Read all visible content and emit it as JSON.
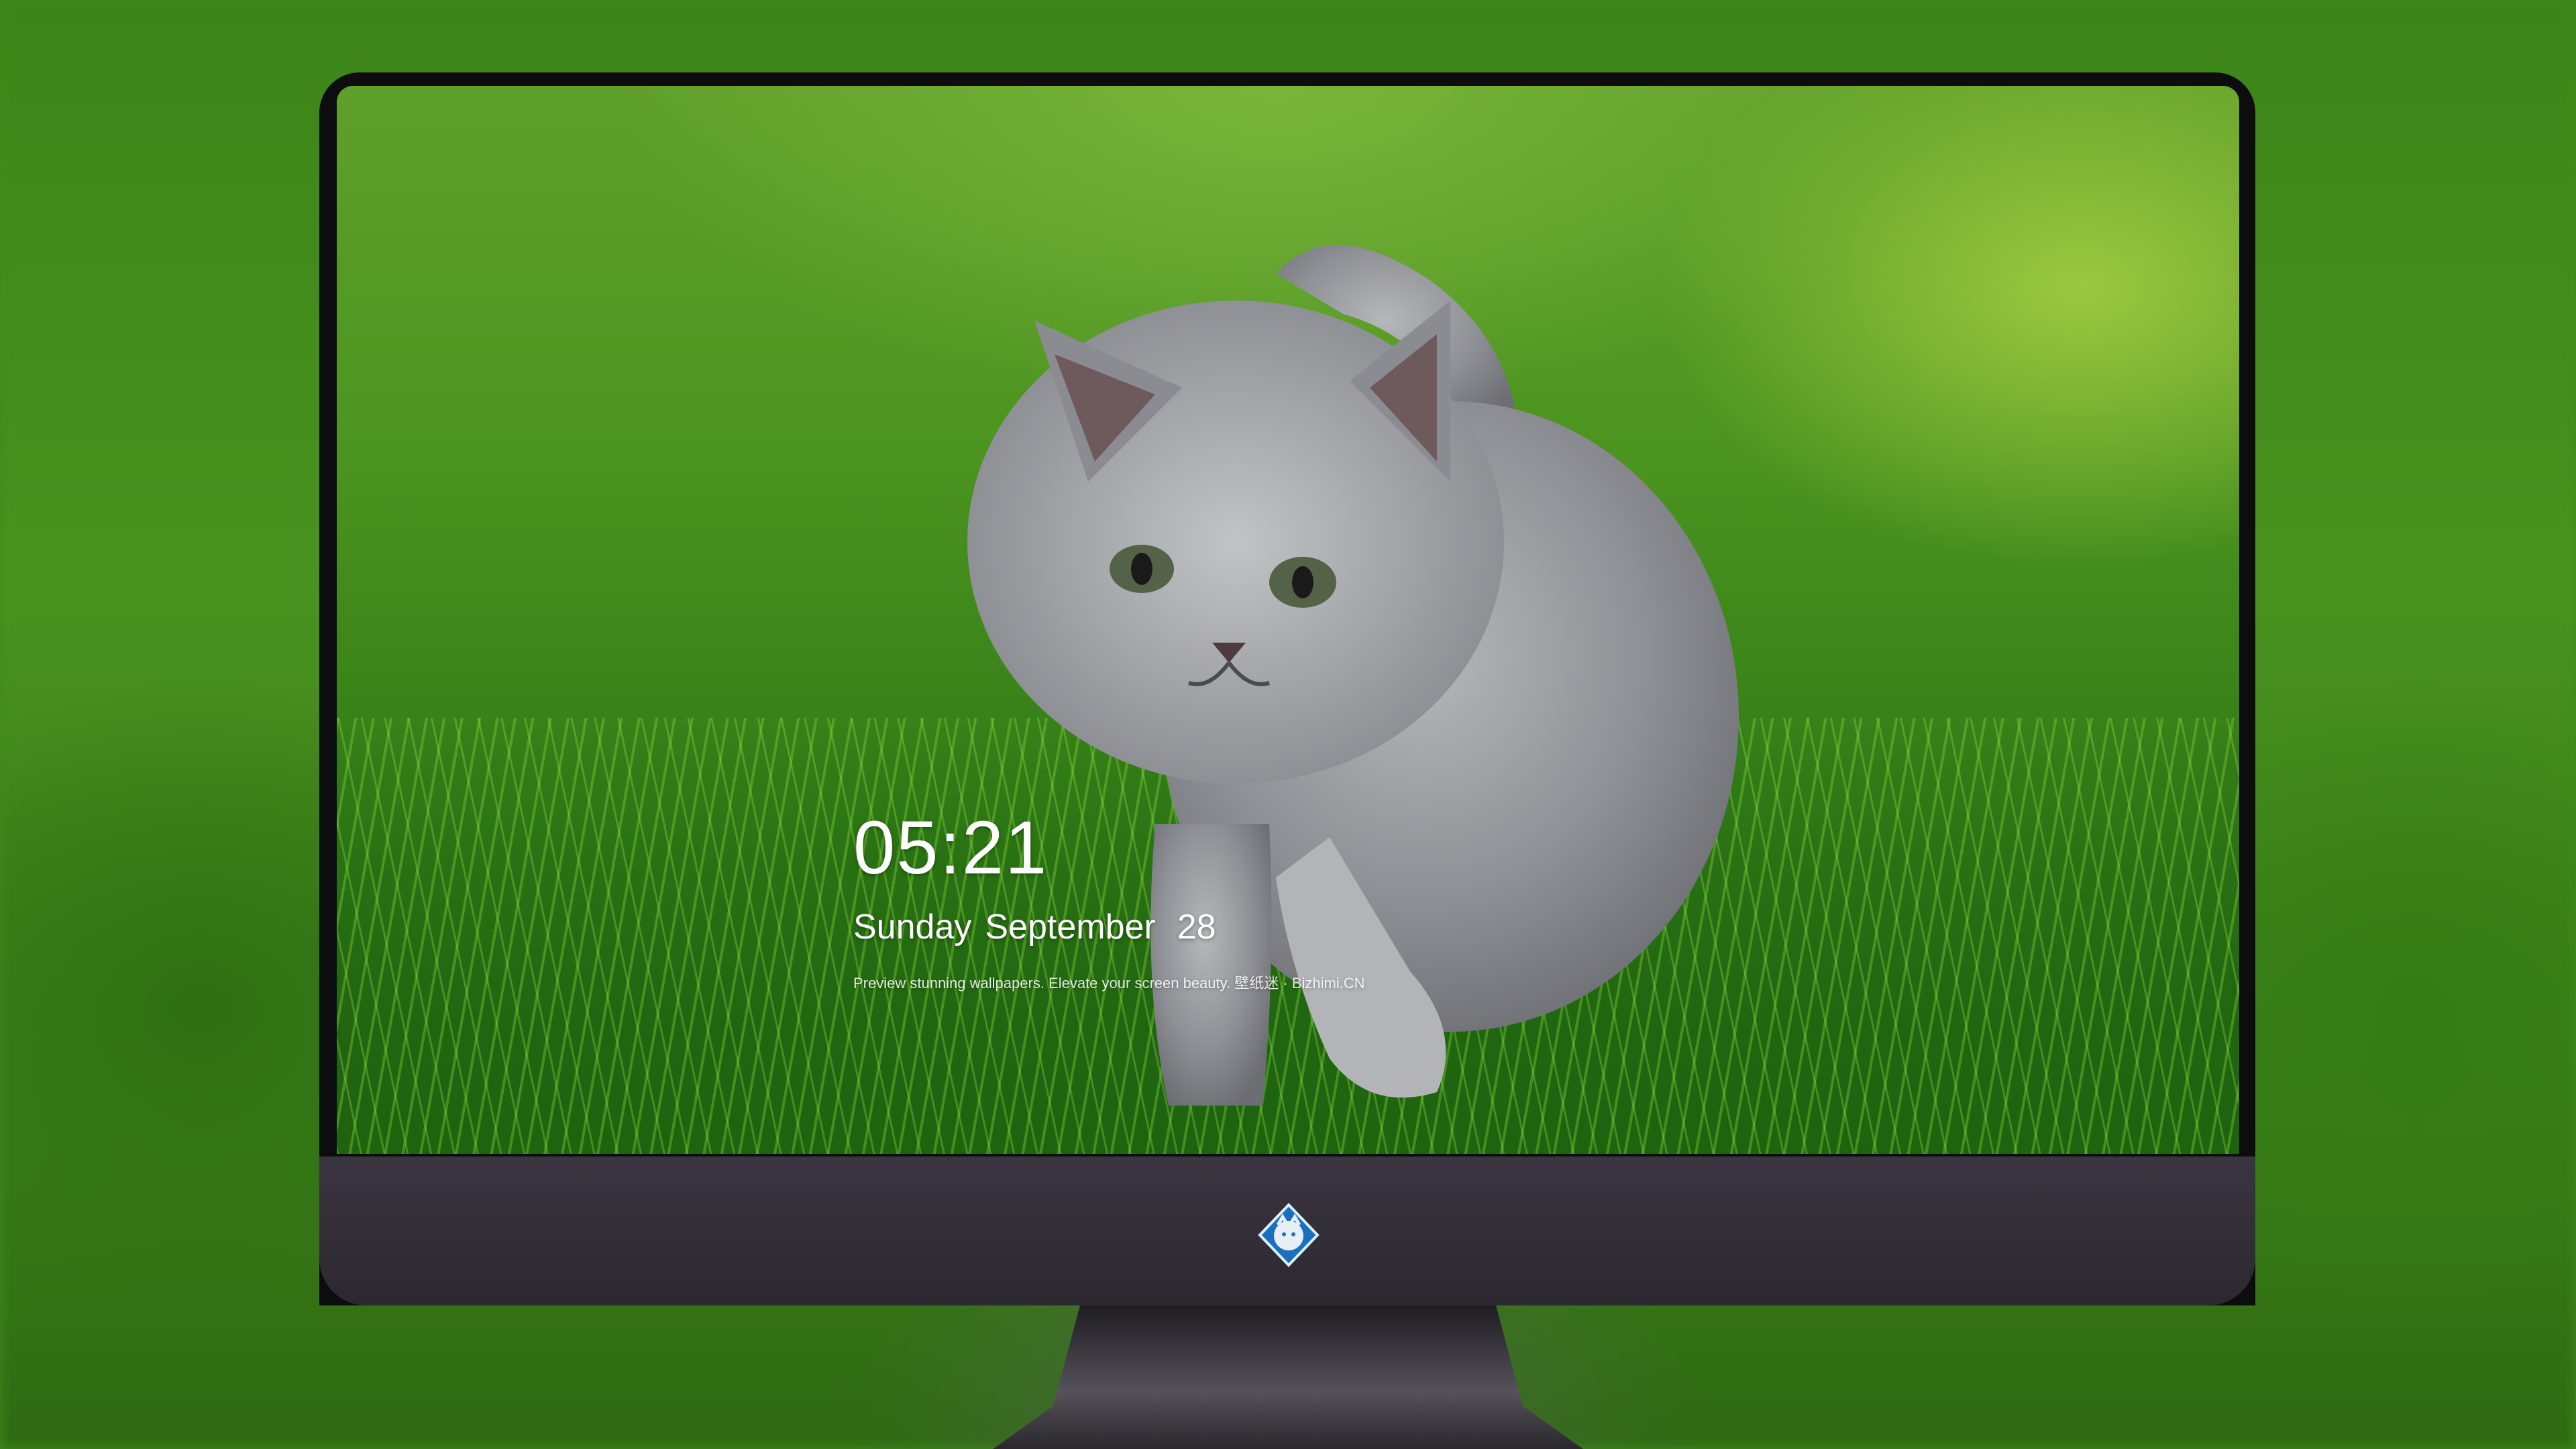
{
  "lockscreen": {
    "time": "05:21",
    "weekday": "Sunday",
    "month": "September",
    "day": "28",
    "caption": "Preview stunning wallpapers. Elevate your screen beauty. 壁纸迷 · Bizhimi.CN"
  },
  "dock": {
    "apps": [
      {
        "name": "messages-icon"
      },
      {
        "name": "weather-icon"
      },
      {
        "name": "clock-icon"
      },
      {
        "name": "preview-icon"
      },
      {
        "name": "video-clapper-icon"
      },
      {
        "name": "notes-icon"
      },
      {
        "name": "photos-icon"
      },
      {
        "name": "music-icon"
      },
      {
        "name": "app-store-icon"
      },
      {
        "name": "camera-icon"
      }
    ]
  },
  "colors": {
    "grass": "#4b9420",
    "bezel": "#0d0d0f",
    "chin": "#3a3540"
  }
}
